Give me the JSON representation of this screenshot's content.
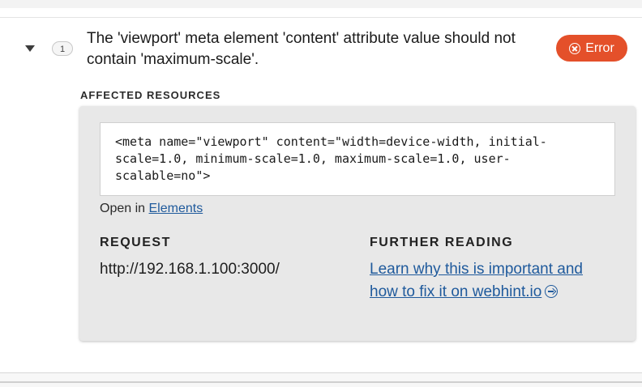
{
  "issue": {
    "count": "1",
    "title": "The 'viewport' meta element 'content' attribute value should not contain 'maximum-scale'.",
    "severity_label": "Error",
    "severity_color": "#e4502a"
  },
  "affected": {
    "label": "AFFECTED RESOURCES",
    "code": "<meta name=\"viewport\" content=\"width=device-width, initial-scale=1.0, minimum-scale=1.0, maximum-scale=1.0, user-scalable=no\">",
    "open_in_prefix": "Open in",
    "open_in_link": "Elements"
  },
  "request": {
    "label": "REQUEST",
    "url": "http://192.168.1.100:3000/"
  },
  "further_reading": {
    "label": "FURTHER READING",
    "link_text": "Learn why this is important and how to fix it on webhint.io"
  },
  "icons": {
    "expand": "caret-down-icon",
    "error": "circle-x-icon",
    "external": "circle-arrow-right-icon"
  },
  "colors": {
    "link": "#1f5a9c",
    "panel_bg": "#e8e8e8"
  }
}
